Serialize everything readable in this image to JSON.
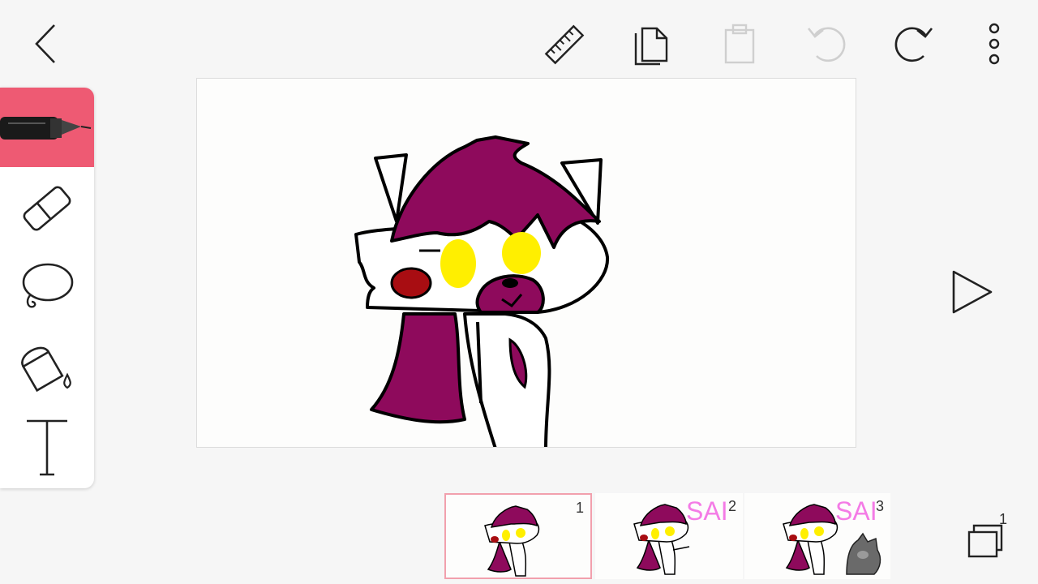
{
  "toolbar": {
    "back_icon": "chevron-left-icon",
    "ruler_icon": "ruler-icon",
    "copy_icon": "copy-icon",
    "paste_icon": "paste-icon",
    "undo_icon": "undo-icon",
    "redo_icon": "redo-icon",
    "more_icon": "more-vertical-icon"
  },
  "tools": [
    {
      "name": "pen",
      "icon": "pen-icon",
      "active": true
    },
    {
      "name": "eraser",
      "icon": "eraser-icon",
      "active": false
    },
    {
      "name": "lasso",
      "icon": "lasso-icon",
      "active": false
    },
    {
      "name": "fill",
      "icon": "paint-bucket-icon",
      "active": false
    },
    {
      "name": "text",
      "icon": "text-icon",
      "active": false
    }
  ],
  "player": {
    "play_icon": "play-icon"
  },
  "frames": [
    {
      "number": "1",
      "text": "",
      "selected": true
    },
    {
      "number": "2",
      "text": "SAI",
      "selected": false
    },
    {
      "number": "3",
      "text": "SAI",
      "selected": false
    }
  ],
  "layers": {
    "count": "1",
    "icon": "layers-icon"
  },
  "colors": {
    "accent": "#ee5a73",
    "hair": "#8e0a5c",
    "eyes": "#ffef00",
    "cheek": "#a80d12",
    "text_pink": "#f47be6"
  }
}
